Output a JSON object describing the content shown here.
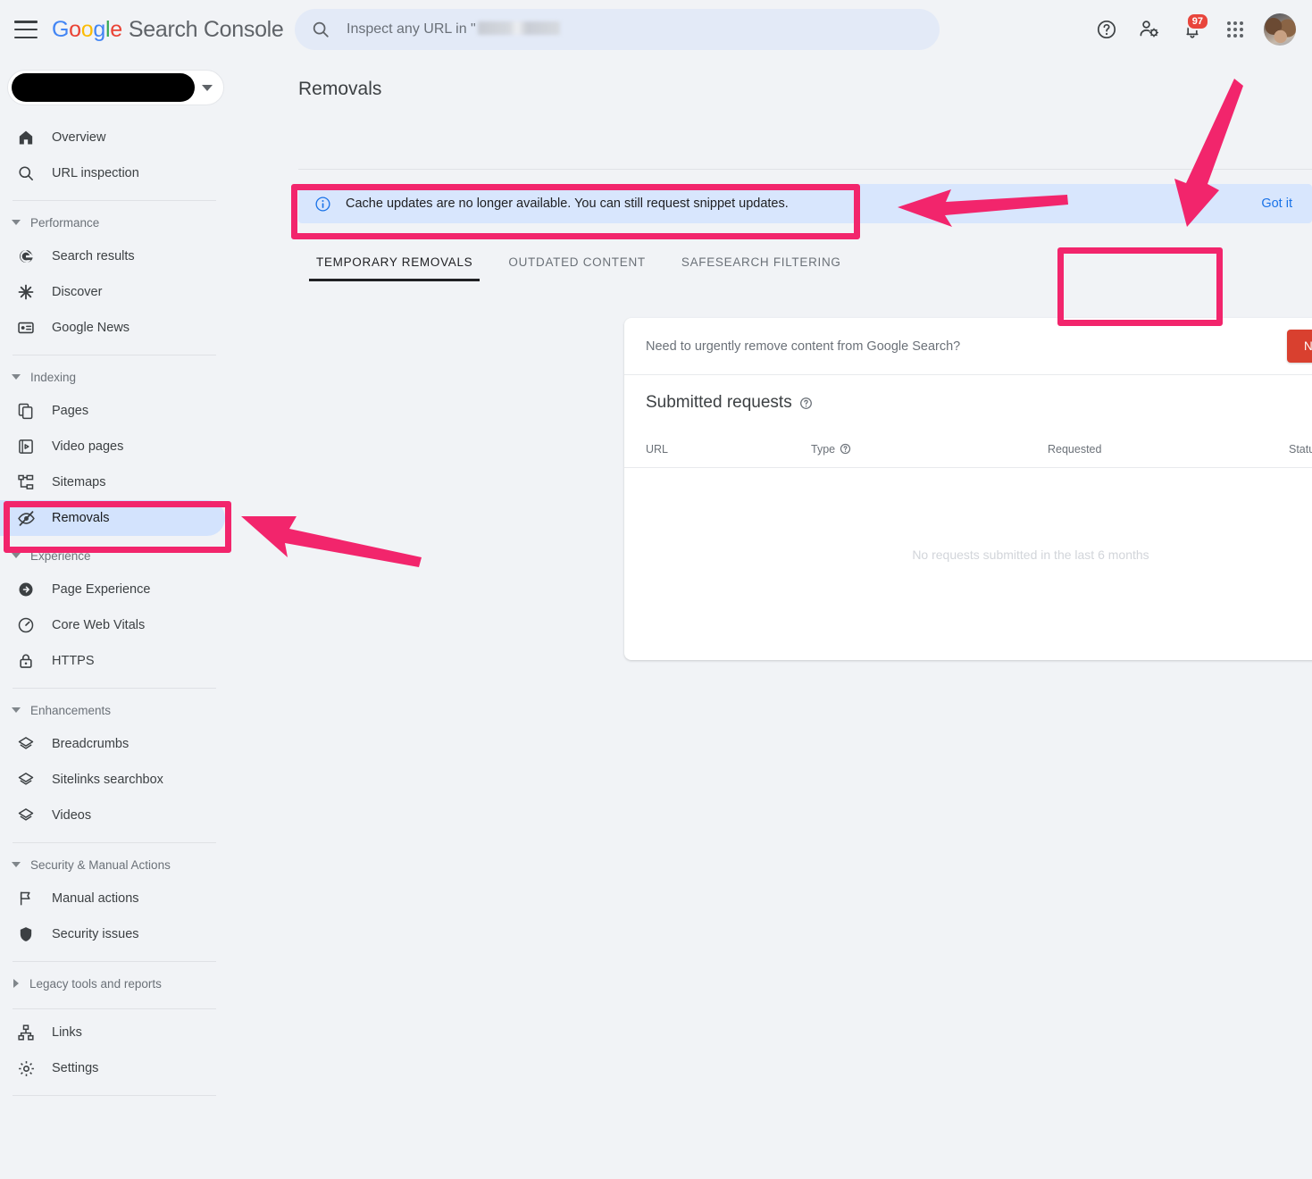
{
  "app": {
    "brand_google": "Google",
    "brand_product": "Search Console",
    "page_title": "Removals"
  },
  "topbar": {
    "menu_icon": "hamburger-menu-icon",
    "search_placeholder_prefix": "Inspect any URL in \"",
    "search_redacted": true,
    "help_icon": "help-circle-icon",
    "user_settings_icon": "person-gear-icon",
    "notifications_icon": "bell-icon",
    "notifications_count": "97",
    "apps_icon": "apps-grid-icon",
    "avatar": "user-avatar"
  },
  "property_selector": {
    "value_redacted": true,
    "caret_icon": "chevron-down-icon"
  },
  "sidebar": {
    "top_items": [
      {
        "label": "Overview",
        "icon": "home-icon",
        "active": false
      },
      {
        "label": "URL inspection",
        "icon": "search-icon",
        "active": false
      }
    ],
    "groups": [
      {
        "label": "Performance",
        "expanded": true,
        "items": [
          {
            "label": "Search results",
            "icon": "google-g-icon",
            "active": false
          },
          {
            "label": "Discover",
            "icon": "asterisk-star-icon",
            "active": false
          },
          {
            "label": "Google News",
            "icon": "news-card-icon",
            "active": false
          }
        ]
      },
      {
        "label": "Indexing",
        "expanded": true,
        "items": [
          {
            "label": "Pages",
            "icon": "pages-copy-icon",
            "active": false
          },
          {
            "label": "Video pages",
            "icon": "video-page-icon",
            "active": false
          },
          {
            "label": "Sitemaps",
            "icon": "sitemap-tree-icon",
            "active": false
          },
          {
            "label": "Removals",
            "icon": "eye-off-icon",
            "active": true
          }
        ]
      },
      {
        "label": "Experience",
        "expanded": true,
        "items": [
          {
            "label": "Page Experience",
            "icon": "page-experience-icon",
            "active": false
          },
          {
            "label": "Core Web Vitals",
            "icon": "speedometer-icon",
            "active": false
          },
          {
            "label": "HTTPS",
            "icon": "lock-icon",
            "active": false
          }
        ]
      },
      {
        "label": "Enhancements",
        "expanded": true,
        "items": [
          {
            "label": "Breadcrumbs",
            "icon": "layers-icon",
            "active": false
          },
          {
            "label": "Sitelinks searchbox",
            "icon": "layers-icon",
            "active": false
          },
          {
            "label": "Videos",
            "icon": "layers-icon",
            "active": false
          }
        ]
      },
      {
        "label": "Security & Manual Actions",
        "expanded": true,
        "items": [
          {
            "label": "Manual actions",
            "icon": "flag-icon",
            "active": false
          },
          {
            "label": "Security issues",
            "icon": "shield-icon",
            "active": false
          }
        ]
      },
      {
        "label": "Legacy tools and reports",
        "expanded": false,
        "items": []
      }
    ],
    "bottom_items": [
      {
        "label": "Links",
        "icon": "links-tree-icon",
        "active": false
      },
      {
        "label": "Settings",
        "icon": "gear-icon",
        "active": false
      }
    ]
  },
  "banner": {
    "icon": "info-circle-icon",
    "text": "Cache updates are no longer available. You can still request snippet updates.",
    "action_label": "Got it"
  },
  "tabs": [
    {
      "label": "TEMPORARY REMOVALS",
      "active": true
    },
    {
      "label": "OUTDATED CONTENT",
      "active": false
    },
    {
      "label": "SAFESEARCH FILTERING",
      "active": false
    }
  ],
  "card": {
    "prompt_text": "Need to urgently remove content from Google Search?",
    "new_request_label": "NEW REQUEST",
    "new_request_color": "#d9402f",
    "section_title": "Submitted requests",
    "section_help_icon": "help-circle-icon",
    "filter_icon": "filter-funnel-icon",
    "table": {
      "columns": [
        "URL",
        "Type",
        "Requested",
        "Status"
      ],
      "type_help_icon": "help-circle-icon",
      "rows": [],
      "empty_message": "No requests submitted in the last 6 months"
    }
  },
  "annotations": {
    "highlight_color": "#f2256c",
    "boxes": [
      {
        "target": "tabs-bar"
      },
      {
        "target": "new-request-button"
      },
      {
        "target": "sidebar-item-removals"
      }
    ],
    "arrows": [
      {
        "target": "tabs-bar",
        "direction": "left"
      },
      {
        "target": "new-request-button",
        "direction": "down-left"
      },
      {
        "target": "sidebar-item-removals",
        "direction": "up-left"
      }
    ]
  }
}
